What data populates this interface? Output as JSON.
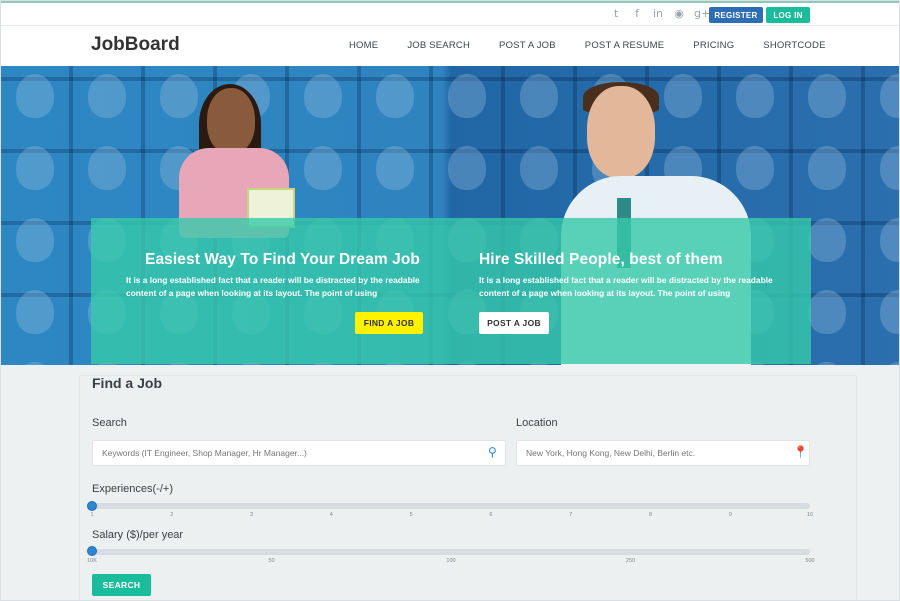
{
  "topbar": {
    "social_icons": [
      "twitter-icon",
      "facebook-icon",
      "linkedin-icon",
      "rss-icon",
      "google-plus-icon"
    ],
    "social_glyphs": [
      "t",
      "f",
      "in",
      "◉",
      "g+"
    ],
    "register_label": "REGISTER",
    "login_label": "LOG IN"
  },
  "header": {
    "logo": "JobBoard",
    "nav": [
      "HOME",
      "JOB SEARCH",
      "POST A JOB",
      "POST A RESUME",
      "PRICING",
      "SHORTCODE"
    ]
  },
  "hero": {
    "left": {
      "title": "Easiest Way To Find Your Dream Job",
      "text_line1": "It is a long established fact that a reader will be distracted by the readable",
      "text_line2": "content of a page when looking at its layout. The point of using",
      "button": "FIND A JOB"
    },
    "right": {
      "title": "Hire Skilled People, best of them",
      "text_line1": "It is a long established fact that a reader will be distracted by the readable",
      "text_line2": "content of a page when looking at its layout. The point of using",
      "button": "POST A JOB"
    }
  },
  "search": {
    "heading": "Find a Job",
    "search_label": "Search",
    "search_placeholder": "Keywords (IT Engineer, Shop Manager, Hr Manager...)",
    "location_label": "Location",
    "location_placeholder": "New York, Hong Kong, New Delhi, Berlin etc.",
    "experience_label": "Experiences(-/+)",
    "experience_ticks": [
      "1",
      "2",
      "3",
      "4",
      "5",
      "6",
      "7",
      "8",
      "9",
      "10"
    ],
    "experience_value": 1,
    "salary_label": "Salary ($)/per year",
    "salary_ticks": [
      "10K",
      "50",
      "100",
      "250",
      "500"
    ],
    "salary_value": "10K",
    "button": "SEARCH"
  },
  "colors": {
    "accent_green": "#1bbc9b",
    "register_blue": "#2c6db4",
    "find_yellow": "#fff200",
    "slider_blue": "#2e88d1"
  }
}
